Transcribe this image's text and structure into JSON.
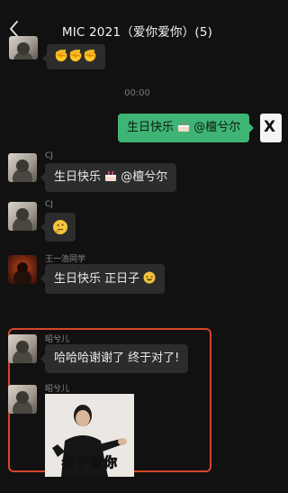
{
  "header": {
    "title": "MIC 2021（爱你爱你）(5)"
  },
  "messages": {
    "top_emoji": "✊✊✊",
    "timestamp": "00:00",
    "me_text": "生日快乐",
    "me_mention": "@檀兮尔",
    "cj1_sender": "CJ",
    "cj1_text": "生日快乐",
    "cj1_mention": "@檀兮尔",
    "cj2_sender": "CJ",
    "wang_sender": "王一浩同学",
    "wang_text": "生日快乐 正日子",
    "zhao1_sender": "昭兮儿",
    "zhao1_text": "哈哈哈谢谢了 终于对了!",
    "zhao2_sender": "昭兮儿",
    "sticker_caption": "老子爱你"
  },
  "side_badge": "X",
  "colors": {
    "background": "#111111",
    "bubble_incoming": "#2c2c2c",
    "bubble_outgoing": "#3eb575",
    "highlight_border": "#d6452b"
  },
  "icons": {
    "back": "chevron-left-icon",
    "cake": "birthday-cake-emoji",
    "fist": "fist-emoji",
    "thinking": "thinking-face-emoji",
    "laugh": "laughing-face-emoji"
  }
}
